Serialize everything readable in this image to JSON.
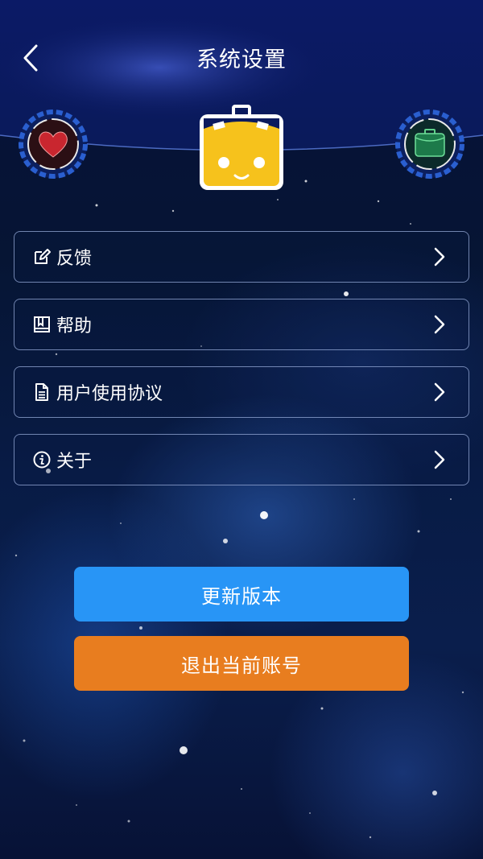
{
  "header": {
    "title": "系统设置",
    "back_icon": "chevron-left-icon"
  },
  "badges": {
    "left_icon": "heart-icon",
    "center_icon": "mascot-icon",
    "right_icon": "briefcase-icon"
  },
  "menu": {
    "items": [
      {
        "label": "反馈",
        "icon": "edit-icon"
      },
      {
        "label": "帮助",
        "icon": "book-icon"
      },
      {
        "label": "用户使用协议",
        "icon": "document-icon"
      },
      {
        "label": "关于",
        "icon": "info-icon"
      }
    ]
  },
  "actions": {
    "update_label": "更新版本",
    "logout_label": "退出当前账号"
  },
  "colors": {
    "update_button": "#2895f6",
    "logout_button": "#e87d1f",
    "mascot": "#f6c21c"
  }
}
